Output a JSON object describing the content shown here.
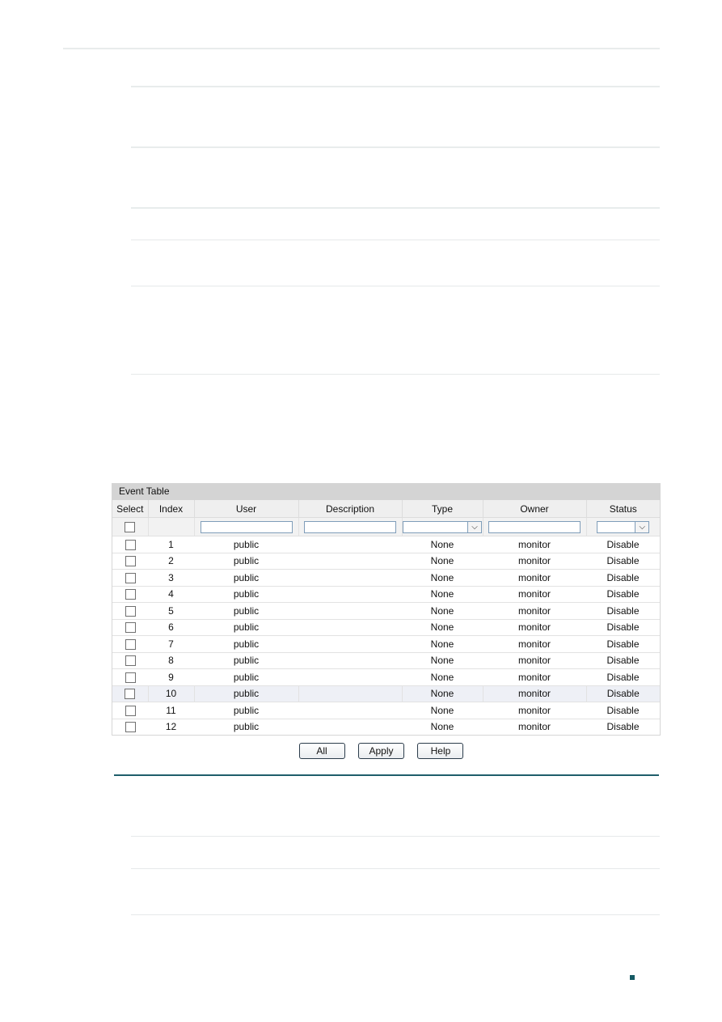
{
  "event_table": {
    "title": "Event Table",
    "columns": [
      "Select",
      "Index",
      "User",
      "Description",
      "Type",
      "Owner",
      "Status"
    ],
    "filter_row": {
      "user_value": "",
      "description_value": "",
      "type_selected": "",
      "owner_value": "",
      "status_selected": ""
    },
    "rows": [
      {
        "index": "1",
        "user": "public",
        "description": "",
        "type": "None",
        "owner": "monitor",
        "status": "Disable"
      },
      {
        "index": "2",
        "user": "public",
        "description": "",
        "type": "None",
        "owner": "monitor",
        "status": "Disable"
      },
      {
        "index": "3",
        "user": "public",
        "description": "",
        "type": "None",
        "owner": "monitor",
        "status": "Disable"
      },
      {
        "index": "4",
        "user": "public",
        "description": "",
        "type": "None",
        "owner": "monitor",
        "status": "Disable"
      },
      {
        "index": "5",
        "user": "public",
        "description": "",
        "type": "None",
        "owner": "monitor",
        "status": "Disable"
      },
      {
        "index": "6",
        "user": "public",
        "description": "",
        "type": "None",
        "owner": "monitor",
        "status": "Disable"
      },
      {
        "index": "7",
        "user": "public",
        "description": "",
        "type": "None",
        "owner": "monitor",
        "status": "Disable"
      },
      {
        "index": "8",
        "user": "public",
        "description": "",
        "type": "None",
        "owner": "monitor",
        "status": "Disable"
      },
      {
        "index": "9",
        "user": "public",
        "description": "",
        "type": "None",
        "owner": "monitor",
        "status": "Disable"
      },
      {
        "index": "10",
        "user": "public",
        "description": "",
        "type": "None",
        "owner": "monitor",
        "status": "Disable"
      },
      {
        "index": "11",
        "user": "public",
        "description": "",
        "type": "None",
        "owner": "monitor",
        "status": "Disable"
      },
      {
        "index": "12",
        "user": "public",
        "description": "",
        "type": "None",
        "owner": "monitor",
        "status": "Disable"
      }
    ],
    "highlighted_row_index": "10"
  },
  "buttons": {
    "all_label": "All",
    "apply_label": "Apply",
    "help_label": "Help"
  },
  "icons": {
    "dropdown": "chevron-down-icon",
    "page_marker": "square-bullet-icon"
  },
  "colors": {
    "accent_line": "#1f5e6b",
    "page_marker": "#155a64",
    "table_title_bg": "#d4d4d4"
  }
}
